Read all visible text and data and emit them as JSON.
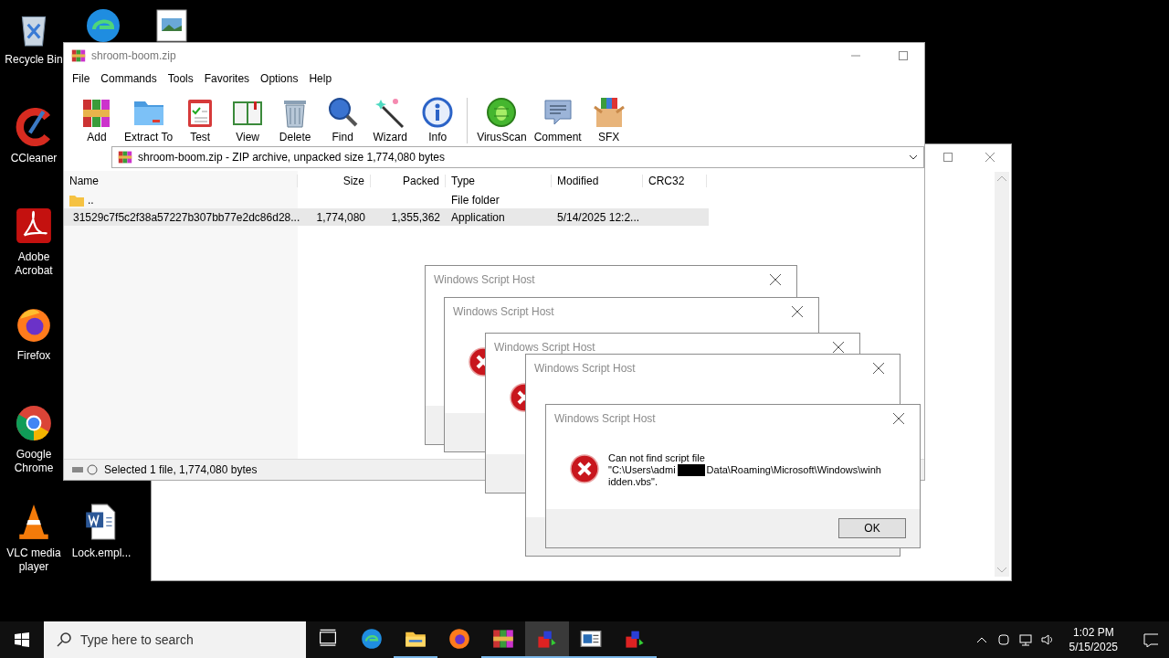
{
  "desktop_icons": [
    {
      "label": "Recycle Bin"
    },
    {
      "label": "CCleaner"
    },
    {
      "label": "Adobe Acrobat"
    },
    {
      "label": "Firefox"
    },
    {
      "label": "Google Chrome"
    },
    {
      "label": "VLC media player"
    },
    {
      "label": "Lock.empl..."
    }
  ],
  "archive_window": {
    "title": "shroom-boom.zip",
    "menu": [
      "File",
      "Commands",
      "Tools",
      "Favorites",
      "Options",
      "Help"
    ],
    "toolbar": [
      "Add",
      "Extract To",
      "Test",
      "View",
      "Delete",
      "Find",
      "Wizard",
      "Info",
      "VirusScan",
      "Comment",
      "SFX"
    ],
    "address": "shroom-boom.zip - ZIP archive, unpacked size 1,774,080 bytes",
    "columns": [
      "Name",
      "Size",
      "Packed",
      "Type",
      "Modified",
      "CRC32"
    ],
    "rows": [
      {
        "kind": "folder",
        "name": "..",
        "type": "File folder",
        "selected": false
      },
      {
        "kind": "file",
        "name": "31529c7f5c2f38a57227b307bb77e2dc86d28...",
        "size": "1,774,080",
        "packed": "1,355,362",
        "type": "Application",
        "modified": "5/14/2025 12:2...",
        "selected": true
      }
    ],
    "status": "Selected 1 file, 1,774,080 bytes"
  },
  "dialogs": [
    {
      "title": "Windows Script Host"
    },
    {
      "title": "Windows Script Host"
    },
    {
      "title": "Windows Script Host"
    },
    {
      "title": "Windows Script Host"
    },
    {
      "title": "Windows Script Host",
      "message": [
        "Can not find script file",
        "\"C:\\Users\\admi",
        "Data\\Roaming\\Microsoft\\Windows\\winh",
        "idden.vbs\"."
      ],
      "button": "OK"
    }
  ],
  "taskbar": {
    "search_placeholder": "Type here to search",
    "apps": [
      {
        "running": false,
        "selected": false
      },
      {
        "running": false,
        "selected": false
      },
      {
        "running": true,
        "selected": false
      },
      {
        "running": false,
        "selected": false
      },
      {
        "running": true,
        "selected": false
      },
      {
        "running": true,
        "selected": true
      },
      {
        "running": true,
        "selected": false
      },
      {
        "running": true,
        "selected": false
      }
    ],
    "time": "1:02 PM",
    "date": "5/15/2025"
  }
}
